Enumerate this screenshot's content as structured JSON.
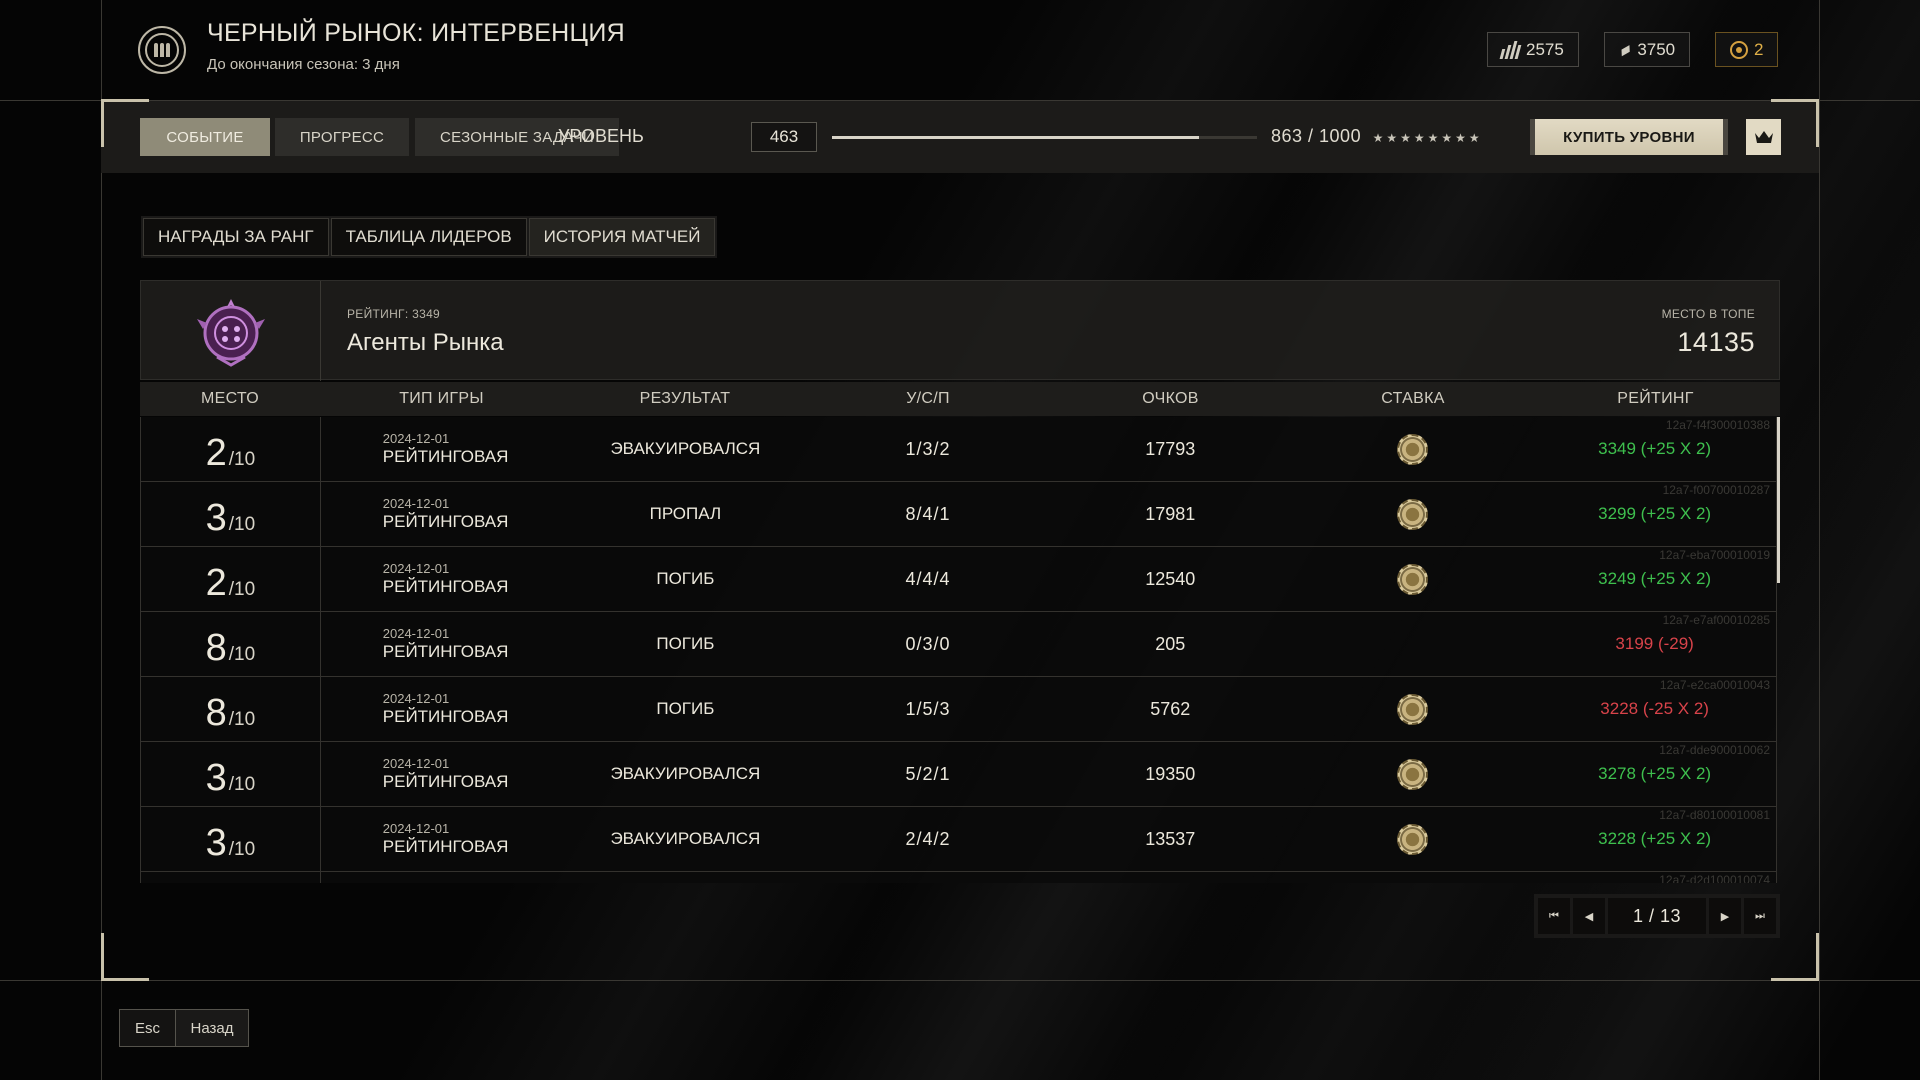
{
  "header": {
    "title": "ЧЕРНЫЙ РЫНОК: ИНТЕРВЕНЦИЯ",
    "subtitle": "До окончания сезона: 3 дня",
    "currencies": [
      {
        "value": "2575",
        "icon": "ammo-bars-icon"
      },
      {
        "value": "3750",
        "icon": "ticket-icon"
      },
      {
        "value": "2",
        "icon": "gold-coin-icon",
        "color": "#e0b048"
      }
    ]
  },
  "nav": {
    "tabs": [
      {
        "label": "СОБЫТИЕ",
        "active": true
      },
      {
        "label": "ПРОГРЕСС",
        "active": false
      },
      {
        "label": "СЕЗОННЫЕ ЗАДАЧИ",
        "active": false
      }
    ],
    "level_label": "УРОВЕНЬ",
    "level_value": "463",
    "progress_text": "863 / 1000",
    "progress_fraction": 0.863,
    "stars": "★★★★★★★★",
    "buy_label": "КУПИТЬ УРОВНИ"
  },
  "subtabs": [
    {
      "label": "НАГРАДЫ ЗА РАНГ",
      "active": false
    },
    {
      "label": "ТАБЛИЦА ЛИДЕРОВ",
      "active": false
    },
    {
      "label": "ИСТОРИЯ МАТЧЕЙ",
      "active": true
    }
  ],
  "card": {
    "rating_label": "РЕЙТИНГ: 3349",
    "team_name": "Агенты Рынка",
    "top_label": "МЕСТО В ТОПЕ",
    "top_value": "14135"
  },
  "table": {
    "headers": [
      "МЕСТО",
      "ТИП ИГРЫ",
      "РЕЗУЛЬТАТ",
      "У/С/П",
      "ОЧКОВ",
      "СТАВКА",
      "РЕЙТИНГ"
    ],
    "rows": [
      {
        "place": "2",
        "of": "/10",
        "date": "2024-12-01",
        "type": "РЕЙТИНГОВАЯ",
        "result": "ЭВАКУИРОВАЛСЯ",
        "ksd": "1/3/2",
        "score": "17793",
        "bet": true,
        "rating": "3349 (+25 X 2)",
        "positive": true,
        "id": "12a7-f4f300010388"
      },
      {
        "place": "3",
        "of": "/10",
        "date": "2024-12-01",
        "type": "РЕЙТИНГОВАЯ",
        "result": "ПРОПАЛ",
        "ksd": "8/4/1",
        "score": "17981",
        "bet": true,
        "rating": "3299 (+25 X 2)",
        "positive": true,
        "id": "12a7-f00700010287"
      },
      {
        "place": "2",
        "of": "/10",
        "date": "2024-12-01",
        "type": "РЕЙТИНГОВАЯ",
        "result": "ПОГИБ",
        "ksd": "4/4/4",
        "score": "12540",
        "bet": true,
        "rating": "3249 (+25 X 2)",
        "positive": true,
        "id": "12a7-eba700010019"
      },
      {
        "place": "8",
        "of": "/10",
        "date": "2024-12-01",
        "type": "РЕЙТИНГОВАЯ",
        "result": "ПОГИБ",
        "ksd": "0/3/0",
        "score": "205",
        "bet": false,
        "rating": "3199 (-29)",
        "positive": false,
        "id": "12a7-e7af00010285"
      },
      {
        "place": "8",
        "of": "/10",
        "date": "2024-12-01",
        "type": "РЕЙТИНГОВАЯ",
        "result": "ПОГИБ",
        "ksd": "1/5/3",
        "score": "5762",
        "bet": true,
        "rating": "3228 (-25 X 2)",
        "positive": false,
        "id": "12a7-e2ca00010043"
      },
      {
        "place": "3",
        "of": "/10",
        "date": "2024-12-01",
        "type": "РЕЙТИНГОВАЯ",
        "result": "ЭВАКУИРОВАЛСЯ",
        "ksd": "5/2/1",
        "score": "19350",
        "bet": true,
        "rating": "3278 (+25 X 2)",
        "positive": true,
        "id": "12a7-dde900010062"
      },
      {
        "place": "3",
        "of": "/10",
        "date": "2024-12-01",
        "type": "РЕЙТИНГОВАЯ",
        "result": "ЭВАКУИРОВАЛСЯ",
        "ksd": "2/4/2",
        "score": "13537",
        "bet": true,
        "rating": "3228 (+25 X 2)",
        "positive": true,
        "id": "12a7-d80100010081"
      },
      {
        "place": "",
        "of": "",
        "date": "",
        "type": "",
        "result": "",
        "ksd": "",
        "score": "",
        "bet": false,
        "rating": "",
        "positive": true,
        "id": "12a7-d2d100010074"
      }
    ]
  },
  "pager": {
    "text": "1 / 13"
  },
  "footer": {
    "esc_key": "Esc",
    "esc_label": "Назад"
  },
  "colors": {
    "positive": "#3ec04e",
    "negative": "#d8434a",
    "accent": "#e2dac4"
  }
}
